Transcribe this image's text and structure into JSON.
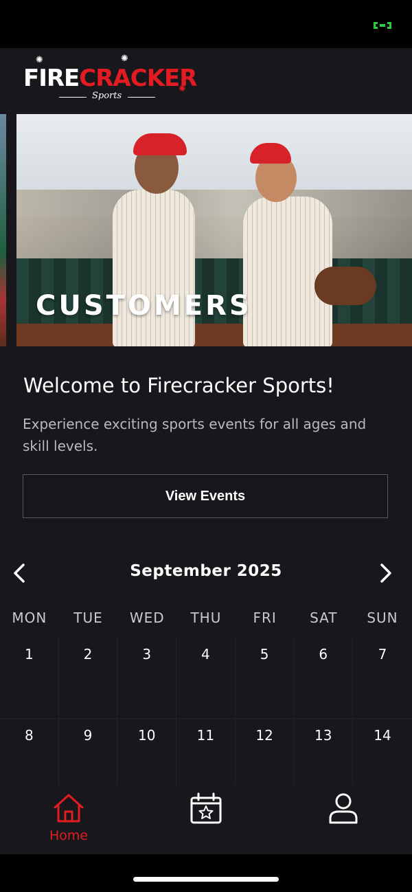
{
  "app": {
    "logo_text_1": "FIRE",
    "logo_text_2": "CRACKER",
    "logo_sub": "Sports",
    "accent": "#e31b23"
  },
  "hero": {
    "title": "CUSTOMERS"
  },
  "welcome": {
    "title": "Welcome to Firecracker Sports!",
    "description": "Experience exciting sports events for all ages and skill levels.",
    "button_label": "View Events"
  },
  "calendar": {
    "month_label": "September 2025",
    "prev_icon": "chevron-left-icon",
    "next_icon": "chevron-right-icon",
    "weekdays": [
      "MON",
      "TUE",
      "WED",
      "THU",
      "FRI",
      "SAT",
      "SUN"
    ],
    "weeks": [
      [
        "1",
        "2",
        "3",
        "4",
        "5",
        "6",
        "7"
      ],
      [
        "8",
        "9",
        "10",
        "11",
        "12",
        "13",
        "14"
      ]
    ]
  },
  "tabbar": {
    "home_label": "Home",
    "home_icon": "home-icon",
    "events_icon": "calendar-star-icon",
    "profile_icon": "user-icon"
  }
}
